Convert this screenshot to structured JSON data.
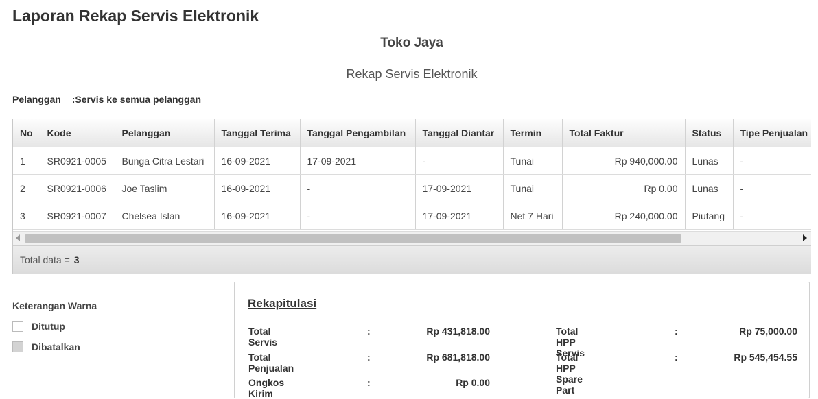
{
  "page": {
    "title": "Laporan Rekap Servis Elektronik",
    "company": "Toko Jaya",
    "report_title": "Rekap Servis Elektronik"
  },
  "filter": {
    "label": "Pelanggan",
    "value": ":Servis ke semua pelanggan"
  },
  "table": {
    "columns": [
      "No",
      "Kode",
      "Pelanggan",
      "Tanggal Terima",
      "Tanggal Pengambilan",
      "Tanggal Diantar",
      "Termin",
      "Total Faktur",
      "Status",
      "Tipe Penjualan"
    ],
    "rows": [
      [
        "1",
        "SR0921-0005",
        "Bunga Citra Lestari",
        "16-09-2021",
        "17-09-2021",
        "-",
        "Tunai",
        "Rp 940,000.00",
        "Lunas",
        "-"
      ],
      [
        "2",
        "SR0921-0006",
        "Joe Taslim",
        "16-09-2021",
        "-",
        "17-09-2021",
        "Tunai",
        "Rp 0.00",
        "Lunas",
        "-"
      ],
      [
        "3",
        "SR0921-0007",
        "Chelsea Islan",
        "16-09-2021",
        "-",
        "17-09-2021",
        "Net 7 Hari",
        "Rp 240,000.00",
        "Piutang",
        "-"
      ]
    ],
    "footer_label": "Total data =",
    "footer_count": "3"
  },
  "legend": {
    "title": "Keterangan Warna",
    "items": [
      {
        "label": "Ditutup",
        "color": "#ffffff"
      },
      {
        "label": "Dibatalkan",
        "color": "#d3d3d3"
      }
    ]
  },
  "summary": {
    "title": "Rekapitulasi",
    "colon": ":",
    "left": [
      {
        "label": "Total Servis",
        "value": "Rp 431,818.00"
      },
      {
        "label": "Total Penjualan",
        "value": "Rp 681,818.00"
      },
      {
        "label": "Ongkos Kirim",
        "value": "Rp 0.00"
      }
    ],
    "right": [
      {
        "label": "Total HPP Servis",
        "value": "Rp 75,000.00"
      },
      {
        "label": "Total HPP Spare Part",
        "value": "Rp 545,454.55"
      }
    ]
  },
  "colors": {
    "link": "#1b73c2",
    "header_bg": "#e6e6e6"
  }
}
